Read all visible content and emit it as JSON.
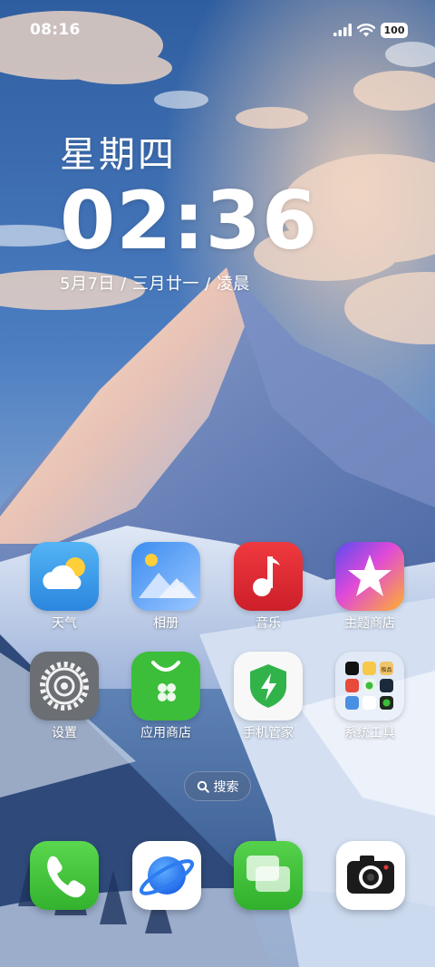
{
  "status_bar": {
    "time": "08:16",
    "battery": "100",
    "icons": [
      "signal-icon",
      "wifi-icon",
      "battery-icon"
    ]
  },
  "clock_widget": {
    "weekday": "星期四",
    "time": "02:36",
    "date": "5月7日 / 三月廿一 / 凌晨"
  },
  "apps": [
    {
      "label": "天气",
      "icon": "weather-icon"
    },
    {
      "label": "相册",
      "icon": "gallery-icon"
    },
    {
      "label": "音乐",
      "icon": "music-icon"
    },
    {
      "label": "主题商店",
      "icon": "theme-store-icon"
    },
    {
      "label": "设置",
      "icon": "settings-gear-icon"
    },
    {
      "label": "应用商店",
      "icon": "app-store-bag-icon"
    },
    {
      "label": "手机管家",
      "icon": "phone-manager-shield-icon"
    },
    {
      "label": "系统工具",
      "icon": "folder-icon"
    }
  ],
  "folder_preview": {
    "badge_text": "极品"
  },
  "search": {
    "label": "搜索",
    "icon": "search-icon"
  },
  "dock": [
    {
      "icon": "phone-icon"
    },
    {
      "icon": "browser-planet-icon"
    },
    {
      "icon": "messages-icon"
    },
    {
      "icon": "camera-icon"
    }
  ],
  "colors": {
    "weather": "#3a9bea",
    "music": "#e02a30",
    "settings": "#6b6e73",
    "app_store": "#3cbe3a",
    "phone": "#40c43a",
    "messages": "#3cc23e"
  }
}
